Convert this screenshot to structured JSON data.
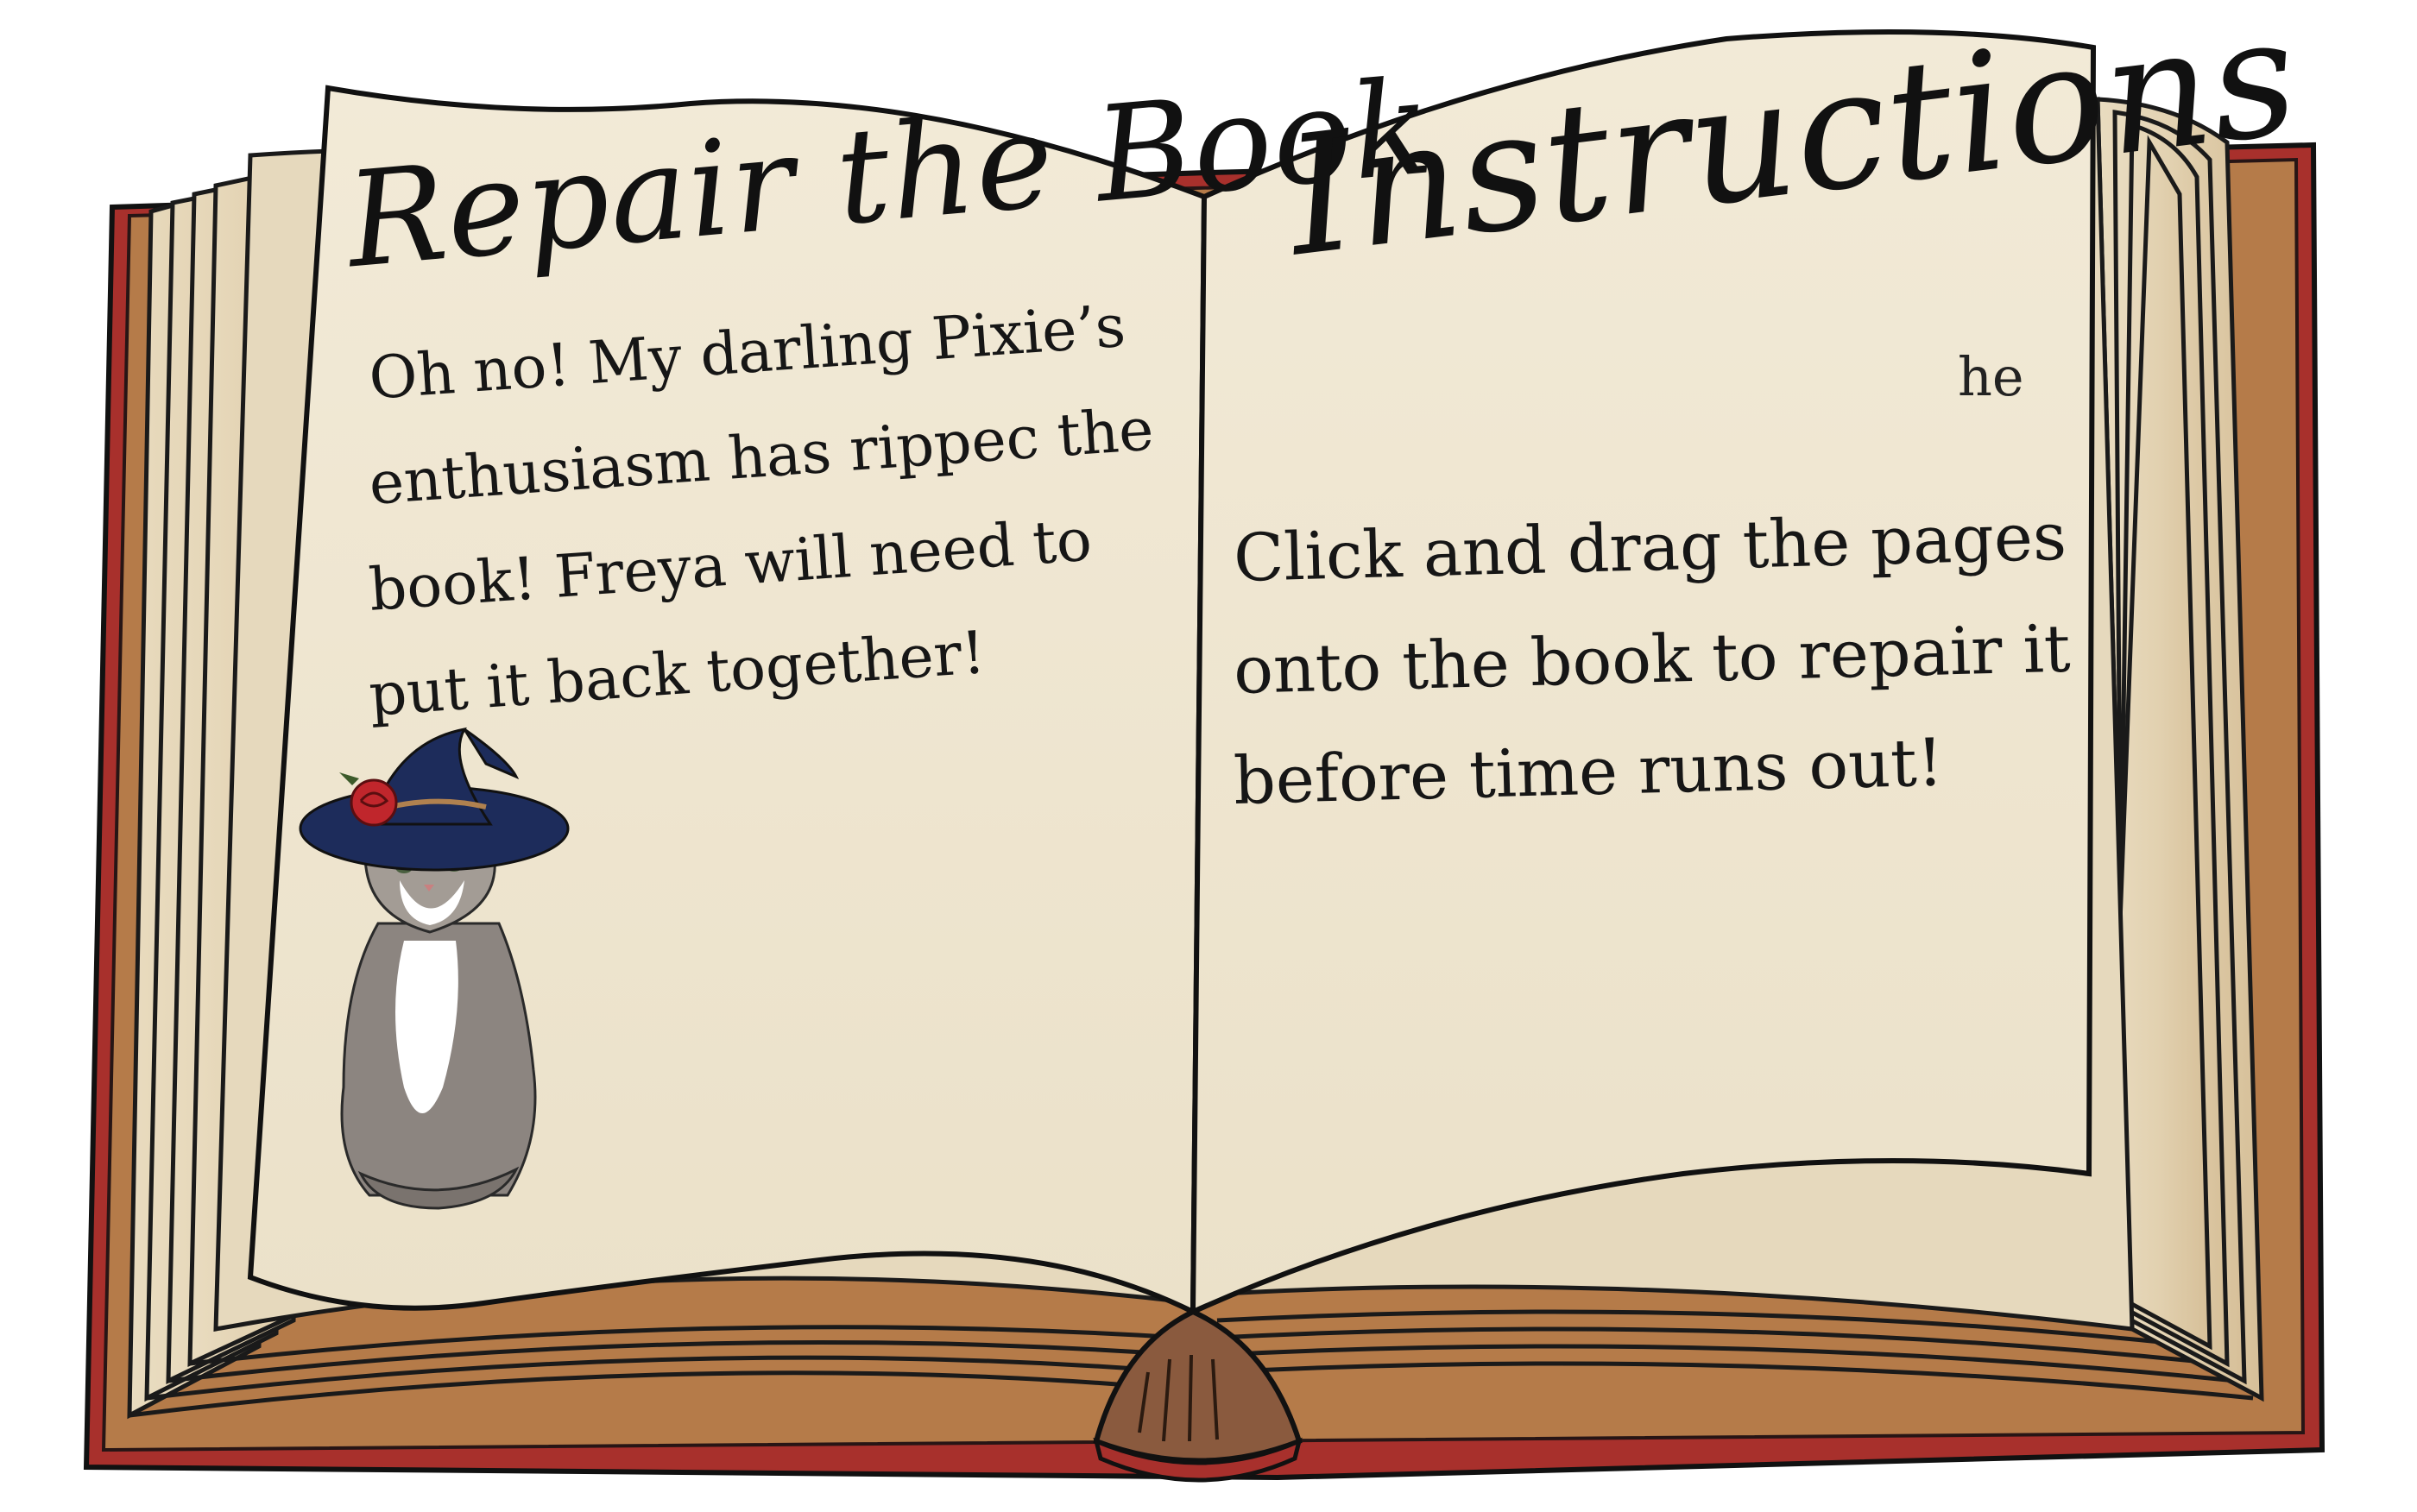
{
  "left_page": {
    "title": "Repair the Book",
    "story_lines": [
      "Oh no! My darling Pixie’s",
      "enthusiasm has rippec  the",
      "book! Freya will need to",
      "put it back together!"
    ]
  },
  "right_page": {
    "title": "Instructions",
    "torn_fragment": "he",
    "instruction_lines": [
      "Click and drag the pages",
      "onto the book to repair it",
      "before time runs out!"
    ]
  },
  "colors": {
    "paper": "#f0e7d2",
    "paper_edge": "#ded3bb",
    "cover_red": "#a8302c",
    "ink": "#111111",
    "bookmark": "#8a5a3e",
    "hat": "#1d2c5b",
    "rose": "#c0262c"
  },
  "icons": {
    "mascot": "witch-cat-icon",
    "bookmark": "ribbon-bookmark-icon"
  }
}
